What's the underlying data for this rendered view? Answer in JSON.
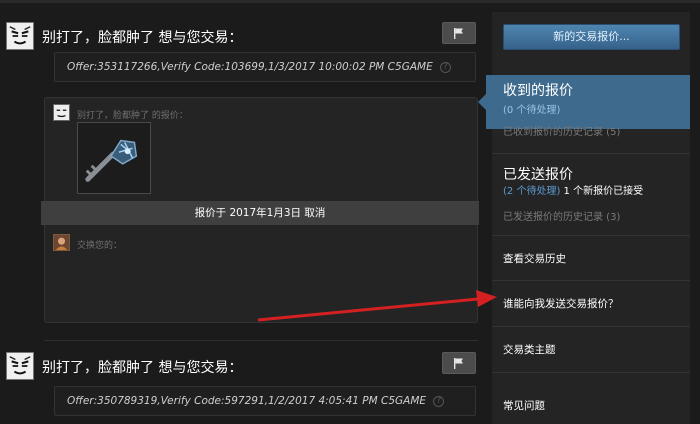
{
  "offers": [
    {
      "title": "别打了，脸都肿了 想与您交易：",
      "message": "Offer:353117266,Verify Code:103699,1/3/2017 10:00:02 PM C5GAME",
      "my_side_label": "别打了，脸都肿了 的报价：",
      "item_icon": "key-icon",
      "status": "报价于 2017年1月3日 取消",
      "their_side_label": "交换您的："
    },
    {
      "title": "别打了，脸都肿了 想与您交易：",
      "message": "Offer:350789319,Verify Code:597291,1/2/2017 4:05:41 PM C5GAME"
    }
  ],
  "sidebar": {
    "new_offer_button": "新的交易报价...",
    "received": {
      "title": "收到的报价",
      "pending": "(0 个待处理)",
      "history": "已收到报价的历史记录 (5)"
    },
    "sent": {
      "title": "已发送报价",
      "pending": "(2 个待处理)",
      "accepted": "1 个新报价已接受",
      "history": "已发送报价的历史记录 (3)"
    },
    "links": [
      "查看交易历史",
      "谁能向我发送交易报价？",
      "交易类主题",
      "常见问题"
    ]
  },
  "colors": {
    "accent": "#3e6a8d",
    "button": "#4677a0",
    "annotation_arrow": "#d42020"
  }
}
